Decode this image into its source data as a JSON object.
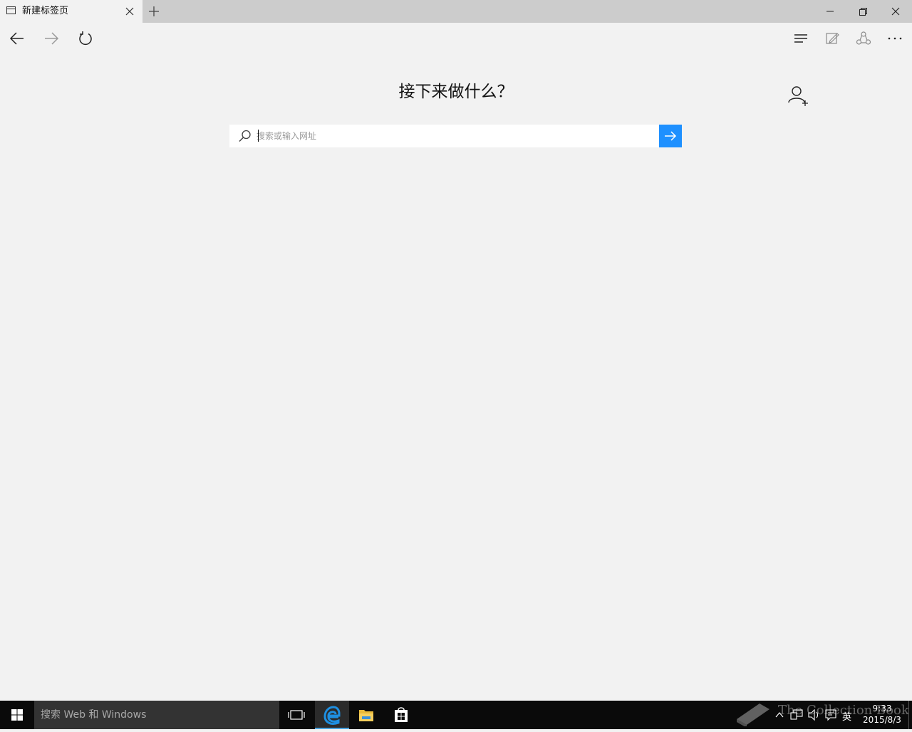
{
  "browser": {
    "tab": {
      "title": "新建标签页",
      "icon": "tab-page-icon"
    },
    "new_tab_icon": "plus-icon",
    "window_controls": [
      "minimize-icon",
      "restore-icon",
      "close-icon"
    ],
    "nav": {
      "back_icon": "back-arrow-icon",
      "forward_icon": "forward-arrow-icon",
      "refresh_icon": "refresh-icon",
      "hub_icon": "hub-icon",
      "web_note_icon": "web-note-icon",
      "share_icon": "share-icon",
      "more_icon": "more-icon"
    }
  },
  "page": {
    "heading": "接下来做什么？",
    "search": {
      "placeholder": "搜索或输入网址",
      "value": ""
    },
    "add_user_icon": "add-user-icon",
    "go_icon": "arrow-right-icon"
  },
  "taskbar": {
    "search_placeholder": "搜索 Web 和 Windows",
    "pinned": [
      "task-view-icon",
      "edge-icon",
      "file-explorer-icon",
      "store-icon"
    ],
    "tray": {
      "ime_label": "英",
      "time": "9:33",
      "date": "2015/8/3"
    },
    "watermark": "The Collection Book"
  },
  "colors": {
    "accent": "#1e90ff",
    "background": "#f2f2f2",
    "tabstrip": "#cccccc",
    "taskbar": "#0a0a0a"
  }
}
